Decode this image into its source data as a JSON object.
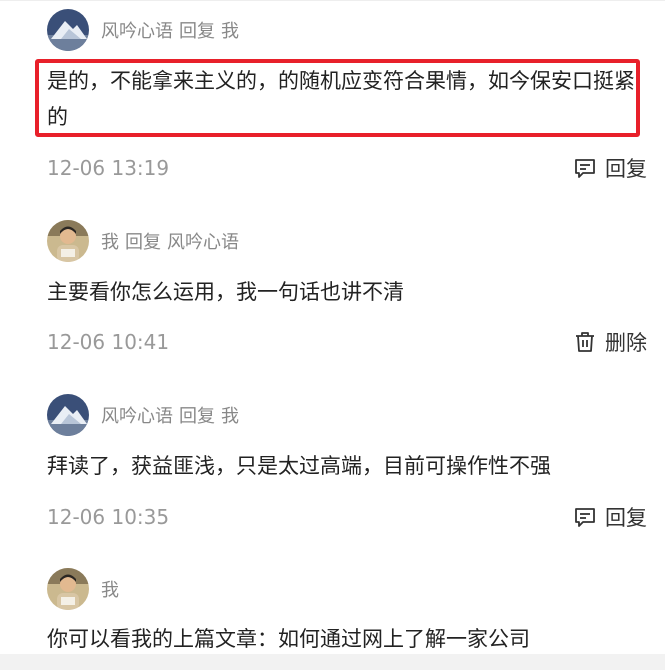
{
  "comments": [
    {
      "meta": {
        "user": "风吟心语",
        "reply_word": "回复",
        "target": "我"
      },
      "text": "是的，不能拿来主义的，的随机应变符合果情，如今保安口挺紧的",
      "time": "12-06 13:19",
      "action": {
        "label": "回复",
        "icon": "reply-icon"
      },
      "avatar": "avatar-mountain"
    },
    {
      "meta": {
        "user": "我",
        "reply_word": "回复",
        "target": "风吟心语"
      },
      "text": "主要看你怎么运用，我一句话也讲不清",
      "time": "12-06 10:41",
      "action": {
        "label": "删除",
        "icon": "trash-icon"
      },
      "avatar": "avatar-person"
    },
    {
      "meta": {
        "user": "风吟心语",
        "reply_word": "回复",
        "target": "我"
      },
      "text": "拜读了，获益匪浅，只是太过高端，目前可操作性不强",
      "time": "12-06 10:35",
      "action": {
        "label": "回复",
        "icon": "reply-icon"
      },
      "avatar": "avatar-mountain"
    },
    {
      "meta": {
        "user": "我"
      },
      "text": "你可以看我的上篇文章：如何通过网上了解一家公司",
      "avatar": "avatar-person"
    }
  ],
  "colors": {
    "highlight": "#e8202a",
    "meta": "#888888",
    "time": "#999999"
  }
}
